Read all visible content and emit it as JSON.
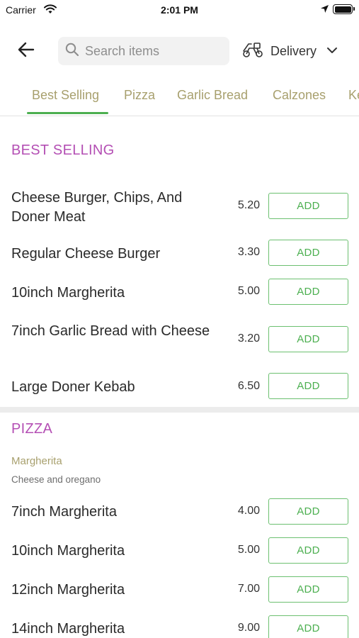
{
  "status_bar": {
    "carrier": "Carrier",
    "time": "2:01 PM"
  },
  "header": {
    "search_placeholder": "Search items",
    "delivery_label": "Delivery"
  },
  "tabs": [
    {
      "label": "Best Selling",
      "active": true
    },
    {
      "label": "Pizza",
      "active": false
    },
    {
      "label": "Garlic Bread",
      "active": false
    },
    {
      "label": "Calzones",
      "active": false
    },
    {
      "label": "Ke",
      "active": false
    }
  ],
  "sections": [
    {
      "title": "BEST SELLING",
      "items": [
        {
          "name": "Cheese Burger, Chips, And Doner Meat",
          "price": "5.20",
          "action": "ADD"
        },
        {
          "name": "Regular Cheese Burger",
          "price": "3.30",
          "action": "ADD"
        },
        {
          "name": "10inch Margherita",
          "price": "5.00",
          "action": "ADD"
        },
        {
          "name": "7inch Garlic Bread with Cheese",
          "price": "3.20",
          "action": "ADD"
        },
        {
          "name": "Large Doner Kebab",
          "price": "6.50",
          "action": "ADD"
        }
      ]
    },
    {
      "title": "PIZZA",
      "subgroup": {
        "title": "Margherita",
        "description": "Cheese and oregano"
      },
      "items": [
        {
          "name": "7inch Margherita",
          "price": "4.00",
          "action": "ADD"
        },
        {
          "name": "10inch Margherita",
          "price": "5.00",
          "action": "ADD"
        },
        {
          "name": "12inch Margherita",
          "price": "7.00",
          "action": "ADD"
        },
        {
          "name": "14inch Margherita",
          "price": "9.00",
          "action": "ADD"
        }
      ]
    }
  ],
  "colors": {
    "accent_green": "#4caf50",
    "section_purple": "#b44fb4",
    "tab_olive": "#a8a06e"
  }
}
